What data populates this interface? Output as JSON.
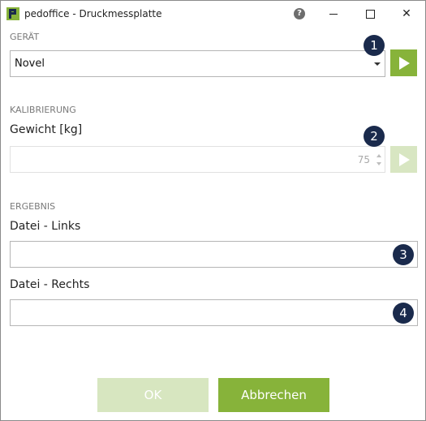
{
  "window": {
    "title": "pedoffice - Druckmessplatte",
    "help_glyph": "?",
    "close_glyph": "✕"
  },
  "device": {
    "section_label": "GERÄT",
    "selected": "Novel",
    "badge": "1"
  },
  "calibration": {
    "section_label": "KALIBRIERUNG",
    "field_label": "Gewicht [kg]",
    "value": "75",
    "badge": "2"
  },
  "result": {
    "section_label": "ERGEBNIS",
    "left_label": "Datei - Links",
    "left_value": "",
    "left_badge": "3",
    "right_label": "Datei - Rechts",
    "right_value": "",
    "right_badge": "4"
  },
  "buttons": {
    "ok": "OK",
    "cancel": "Abbrechen"
  },
  "colors": {
    "accent": "#87b33a",
    "accent_disabled": "#d7e6c0",
    "badge": "#1a2a4c"
  }
}
